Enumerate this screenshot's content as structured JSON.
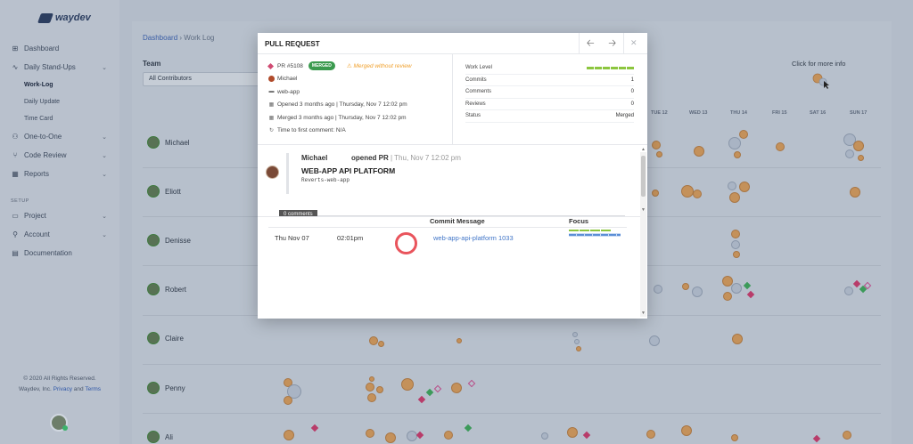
{
  "app": {
    "name": "waydev"
  },
  "sidebar": {
    "items": [
      {
        "label": "Dashboard"
      },
      {
        "label": "Daily Stand-Ups"
      },
      {
        "label": "One-to-One"
      },
      {
        "label": "Code Review"
      },
      {
        "label": "Reports"
      }
    ],
    "sub_items": [
      {
        "label": "Work-Log"
      },
      {
        "label": "Daily Update"
      },
      {
        "label": "Time Card"
      }
    ],
    "setup_label": "SETUP",
    "setup_items": [
      {
        "label": "Project"
      },
      {
        "label": "Account"
      },
      {
        "label": "Documentation"
      }
    ],
    "footer_line1": "© 2020 All Rights Reserved.",
    "footer_line2_prefix": "Waydev, Inc.",
    "footer_privacy": "Privacy",
    "footer_and": "and",
    "footer_terms": "Terms"
  },
  "breadcrumb": {
    "root": "Dashboard",
    "sep": "›",
    "current": "Work Log"
  },
  "filters": {
    "team_label": "Team",
    "team_value": "All Contributors"
  },
  "more_info": "Click for more info",
  "days": [
    "TUE 12",
    "WED 13",
    "THU 14",
    "FRI 15",
    "SAT 16",
    "SUN 17"
  ],
  "people": [
    "Michael",
    "Eliott",
    "Denisse",
    "Robert",
    "Claire",
    "Penny",
    "Ali"
  ],
  "modal": {
    "title": "PULL REQUEST",
    "pr_number": "PR #5108",
    "status_badge": "MERGED",
    "warning": "Merged without review",
    "author": "Michael",
    "repo": "web-app",
    "opened": "Opened 3 months ago | Thursday, Nov 7 12:02 pm",
    "merged": "Merged 3 months ago | Thursday, Nov 7 12:02 pm",
    "first_comment": "Time to first comment: N/A",
    "stats": [
      {
        "label": "Work Level",
        "value": ""
      },
      {
        "label": "Commits",
        "value": "1"
      },
      {
        "label": "Comments",
        "value": "0"
      },
      {
        "label": "Reviews",
        "value": "0"
      },
      {
        "label": "Status",
        "value": "Merged"
      }
    ],
    "comment": {
      "author": "Michael",
      "action": "opened PR",
      "date": "| Thu, Nov 7 12:02 pm",
      "title": "WEB-APP API PLATFORM",
      "body": "Reverts-web-app"
    },
    "comments_tab": "0 comments",
    "commits_table": {
      "headers": {
        "message": "Commit Message",
        "focus": "Focus"
      },
      "rows": [
        {
          "date": "Thu Nov 07",
          "time": "02:01pm",
          "message": "web-app-api-platform 1033"
        }
      ]
    }
  },
  "colors": {
    "accent_green": "#3a9a4e",
    "warning": "#f0a02c",
    "link": "#3f74c7",
    "circle": "#e9545c"
  }
}
